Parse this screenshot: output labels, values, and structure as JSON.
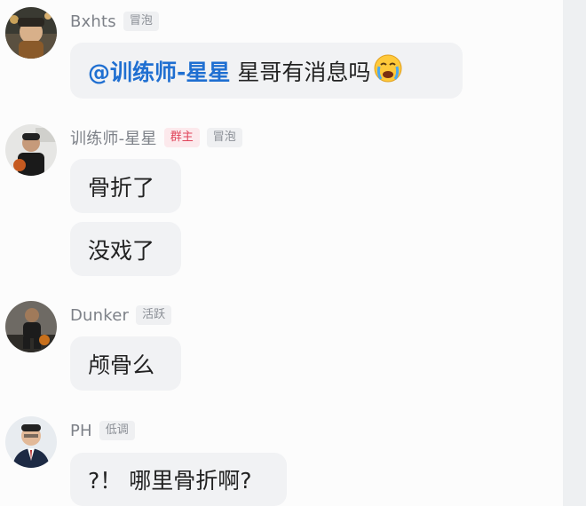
{
  "messages": [
    {
      "username": "Bxhts",
      "badge": "冒泡",
      "bubbles": [
        {
          "mention": "@训练师-星星",
          "text": "星哥有消息吗",
          "emoji": "crying-emoji"
        }
      ]
    },
    {
      "username": "训练师-星星",
      "owner_badge": "群主",
      "badge": "冒泡",
      "bubbles": [
        {
          "text": "骨折了"
        },
        {
          "text": "没戏了"
        }
      ]
    },
    {
      "username": "Dunker",
      "badge": "活跃",
      "bubbles": [
        {
          "text": "颅骨么"
        }
      ]
    },
    {
      "username": "PH",
      "badge": "低调",
      "bubbles": [
        {
          "text": "?！ 哪里骨折啊?"
        }
      ]
    }
  ],
  "colors": {
    "mention": "#1f6fd1",
    "owner_badge": "#e0445a",
    "bubble_bg": "#f1f2f4"
  }
}
